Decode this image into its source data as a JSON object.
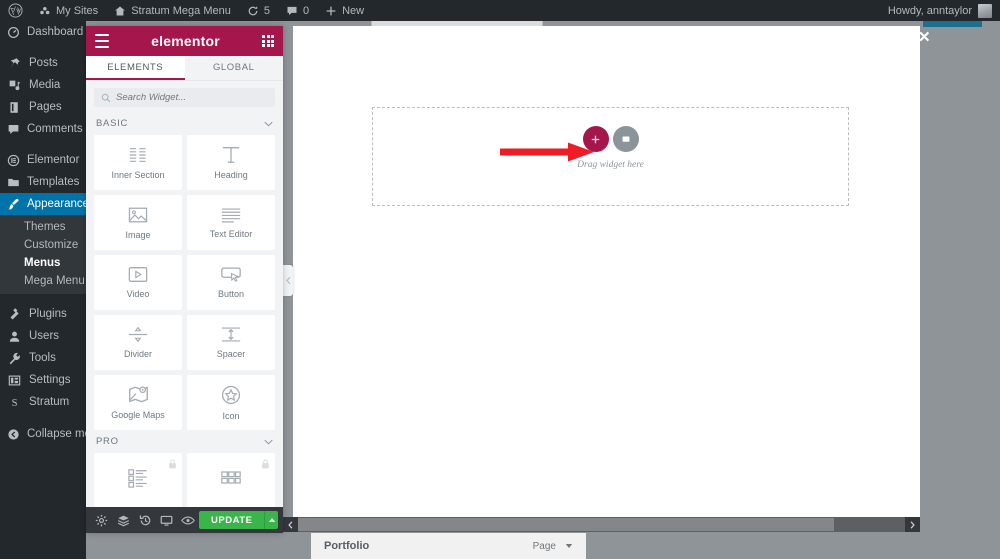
{
  "adminbar": {
    "wp_logo": "wordpress-icon",
    "items": [
      {
        "label": "My Sites",
        "icon": "sites-icon"
      },
      {
        "label": "Stratum Mega Menu",
        "icon": "home-icon"
      },
      {
        "label": "5",
        "icon": "updates-icon"
      },
      {
        "label": "0",
        "icon": "comment-icon"
      },
      {
        "label": "New",
        "icon": "plus-icon"
      }
    ],
    "howdy": "Howdy, anntaylor"
  },
  "wpmenu": {
    "items": [
      {
        "label": "Dashboard",
        "icon": "dashboard-icon",
        "current": false,
        "spaced": false
      },
      {
        "label": "Posts",
        "icon": "pin-icon",
        "current": false,
        "spaced": true
      },
      {
        "label": "Media",
        "icon": "media-icon",
        "current": false,
        "spaced": false
      },
      {
        "label": "Pages",
        "icon": "page-icon",
        "current": false,
        "spaced": false
      },
      {
        "label": "Comments",
        "icon": "comment-icon",
        "current": false,
        "spaced": false
      },
      {
        "label": "Elementor",
        "icon": "elementor-icon",
        "current": false,
        "spaced": true
      },
      {
        "label": "Templates",
        "icon": "folder-icon",
        "current": false,
        "spaced": false
      },
      {
        "label": "Appearance",
        "icon": "brush-icon",
        "current": true,
        "spaced": false
      }
    ],
    "submenu": [
      {
        "label": "Themes",
        "current": false
      },
      {
        "label": "Customize",
        "current": false
      },
      {
        "label": "Menus",
        "current": true
      },
      {
        "label": "Mega Menu",
        "current": false
      }
    ],
    "items_after": [
      {
        "label": "Plugins",
        "icon": "plugin-icon",
        "current": false,
        "spaced": true
      },
      {
        "label": "Users",
        "icon": "user-icon",
        "current": false,
        "spaced": false
      },
      {
        "label": "Tools",
        "icon": "wrench-icon",
        "current": false,
        "spaced": false
      },
      {
        "label": "Settings",
        "icon": "settings-icon",
        "current": false,
        "spaced": false
      },
      {
        "label": "Stratum",
        "icon": "stratum-icon",
        "current": false,
        "spaced": false
      }
    ],
    "collapse": {
      "label": "Collapse menu",
      "icon": "collapse-icon"
    }
  },
  "panel": {
    "logo": "elementor",
    "menu_icon": "hamburger-icon",
    "grid_icon": "grid-icon",
    "tabs": [
      {
        "label": "ELEMENTS",
        "active": true
      },
      {
        "label": "GLOBAL",
        "active": false
      }
    ],
    "search": {
      "placeholder": "Search Widget...",
      "value": "",
      "icon": "search-icon"
    },
    "sections": [
      {
        "title": "BASIC",
        "widgets": [
          {
            "label": "Inner Section",
            "icon": "columns-icon",
            "locked": false
          },
          {
            "label": "Heading",
            "icon": "heading-t-icon",
            "locked": false
          },
          {
            "label": "Image",
            "icon": "image-icon",
            "locked": false
          },
          {
            "label": "Text Editor",
            "icon": "text-lines-icon",
            "locked": false
          },
          {
            "label": "Video",
            "icon": "video-play-icon",
            "locked": false
          },
          {
            "label": "Button",
            "icon": "button-cursor-icon",
            "locked": false
          },
          {
            "label": "Divider",
            "icon": "divider-icon",
            "locked": false
          },
          {
            "label": "Spacer",
            "icon": "spacer-arrows-icon",
            "locked": false
          },
          {
            "label": "Google Maps",
            "icon": "map-pin-icon",
            "locked": false
          },
          {
            "label": "Icon",
            "icon": "star-circle-icon",
            "locked": false
          }
        ]
      },
      {
        "title": "PRO",
        "widgets": [
          {
            "label": "",
            "icon": "posts-list-icon",
            "locked": true
          },
          {
            "label": "",
            "icon": "portfolio-grid-icon",
            "locked": true
          }
        ]
      }
    ],
    "footer": {
      "buttons": [
        {
          "name": "settings",
          "icon": "gear-icon"
        },
        {
          "name": "navigator",
          "icon": "layers-icon"
        },
        {
          "name": "history",
          "icon": "history-icon"
        },
        {
          "name": "responsive",
          "icon": "monitor-icon"
        },
        {
          "name": "preview",
          "icon": "eye-icon"
        }
      ],
      "update_label": "UPDATE",
      "update_arrow_icon": "caret-up-icon"
    },
    "collapse_handle_icon": "chevron-left-icon"
  },
  "canvas": {
    "dropzone": {
      "add_icon": "plus-icon",
      "template_icon": "folder-template-icon",
      "caption": "Drag widget here"
    },
    "annotation_arrow": "red-arrow-icon"
  },
  "overlay": {
    "close_icon": "close-icon"
  },
  "scrollbar": {
    "left_arrow_icon": "chevron-left-icon",
    "right_arrow_icon": "chevron-right-icon"
  },
  "bottom": {
    "page_title": "Portfolio",
    "type_label": "Page",
    "caret_icon": "caret-down-icon"
  },
  "colors": {
    "elementor_magenta": "#a4164c",
    "wp_dark": "#23282d",
    "wp_blue": "#0073aa",
    "update_green": "#39b54a",
    "arrow_red": "#ee1c25",
    "canvas_gray": "#8f9499"
  }
}
